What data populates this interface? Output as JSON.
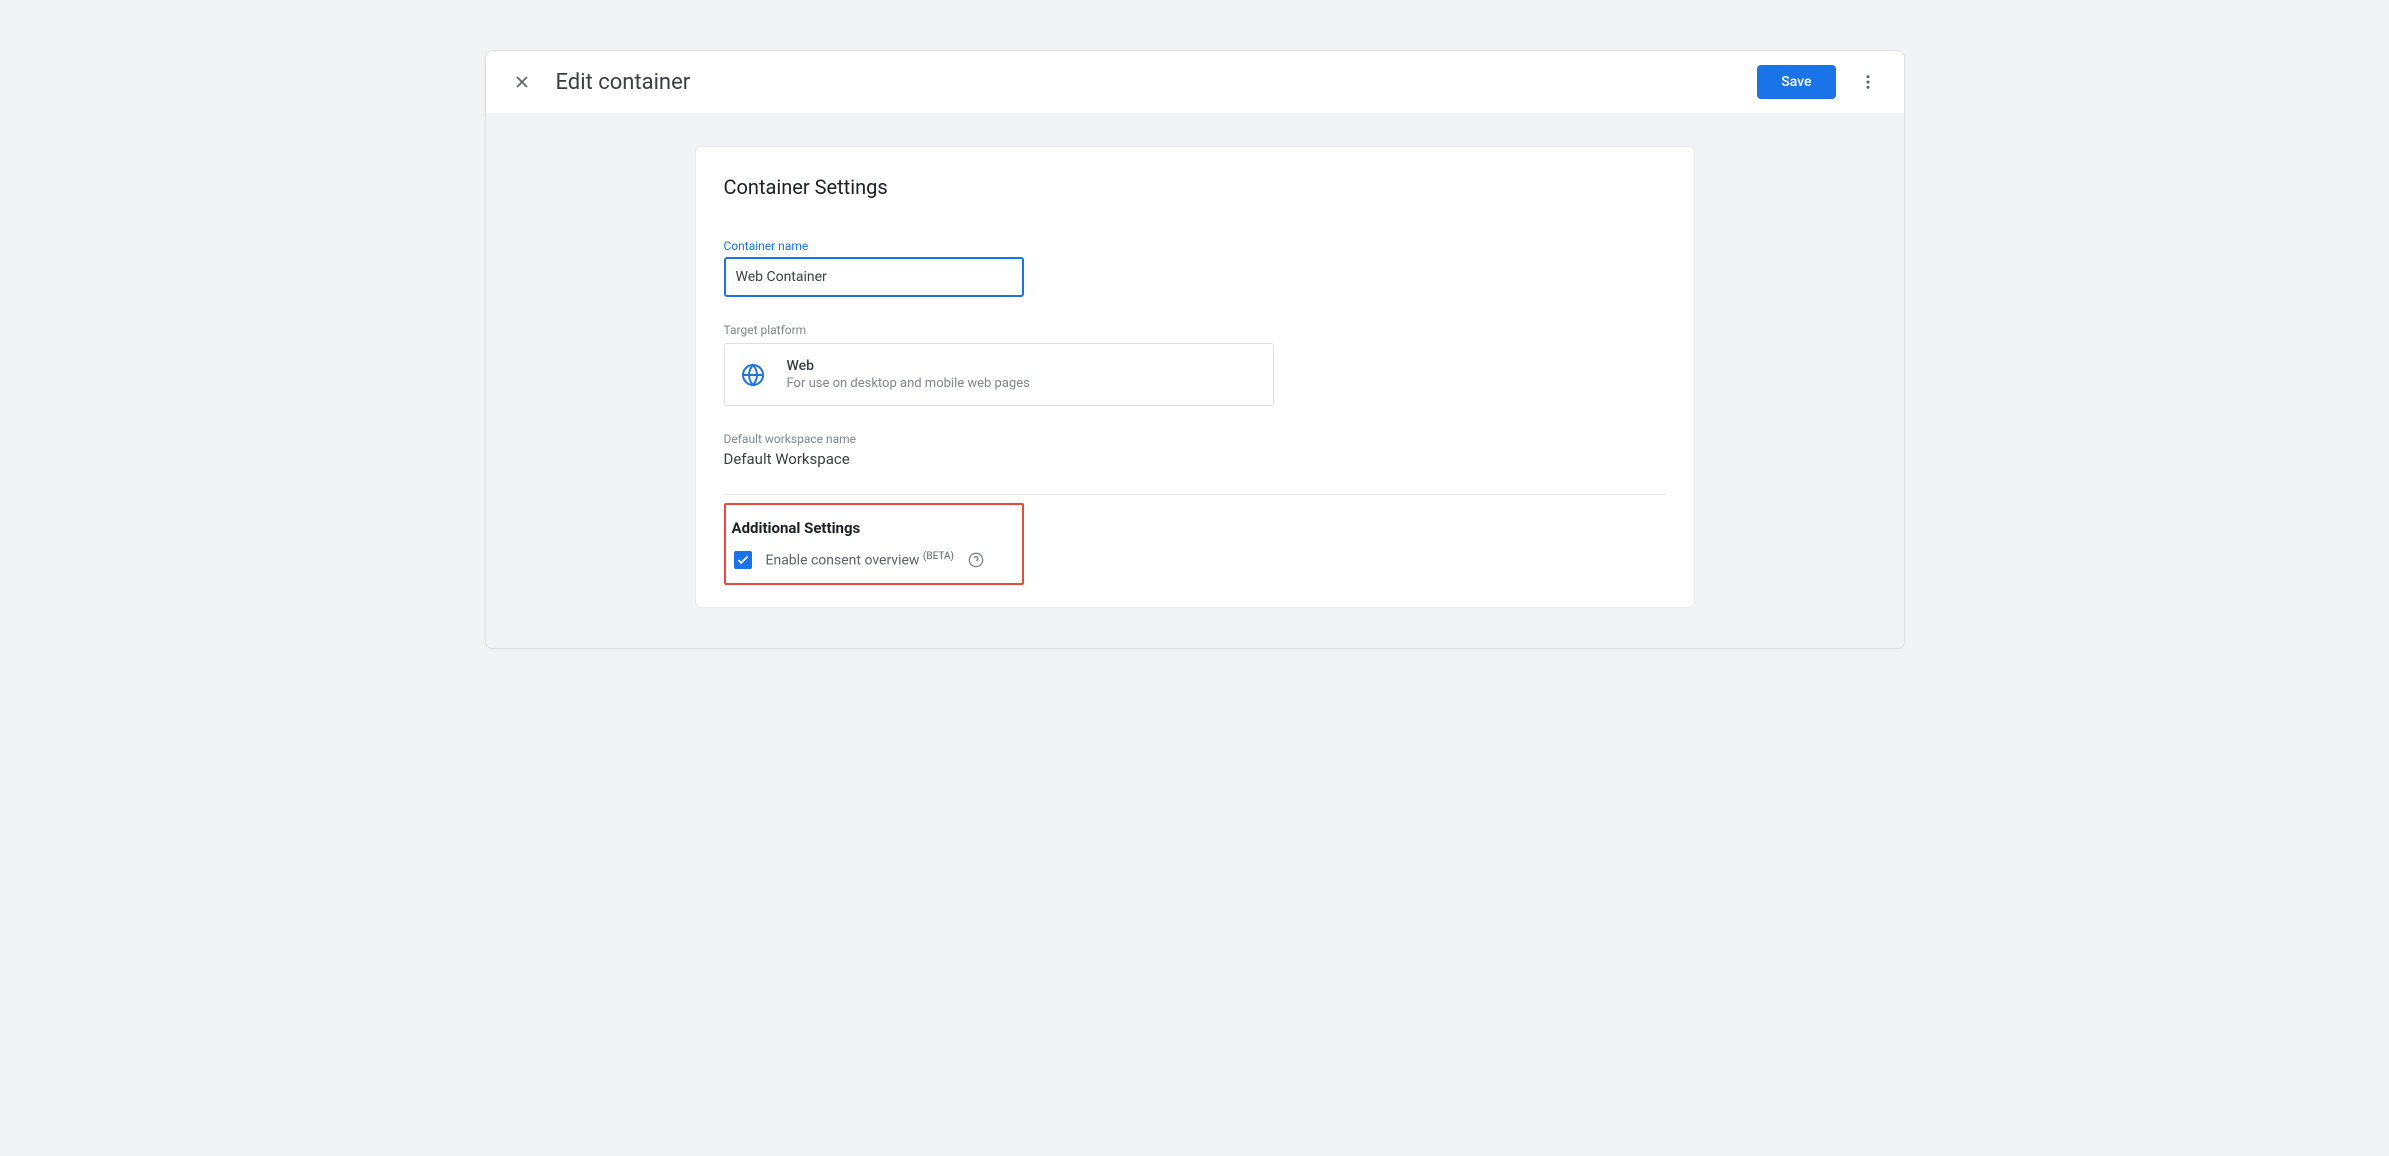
{
  "header": {
    "title": "Edit container",
    "save_label": "Save"
  },
  "settings": {
    "heading": "Container Settings",
    "name_label": "Container name",
    "name_value": "Web Container",
    "platform_label": "Target platform",
    "platform_name": "Web",
    "platform_desc": "For use on desktop and mobile web pages",
    "workspace_label": "Default workspace name",
    "workspace_value": "Default Workspace"
  },
  "additional": {
    "heading": "Additional Settings",
    "consent_label": "Enable consent overview ",
    "beta_tag": "(BETA)",
    "consent_checked": true
  }
}
